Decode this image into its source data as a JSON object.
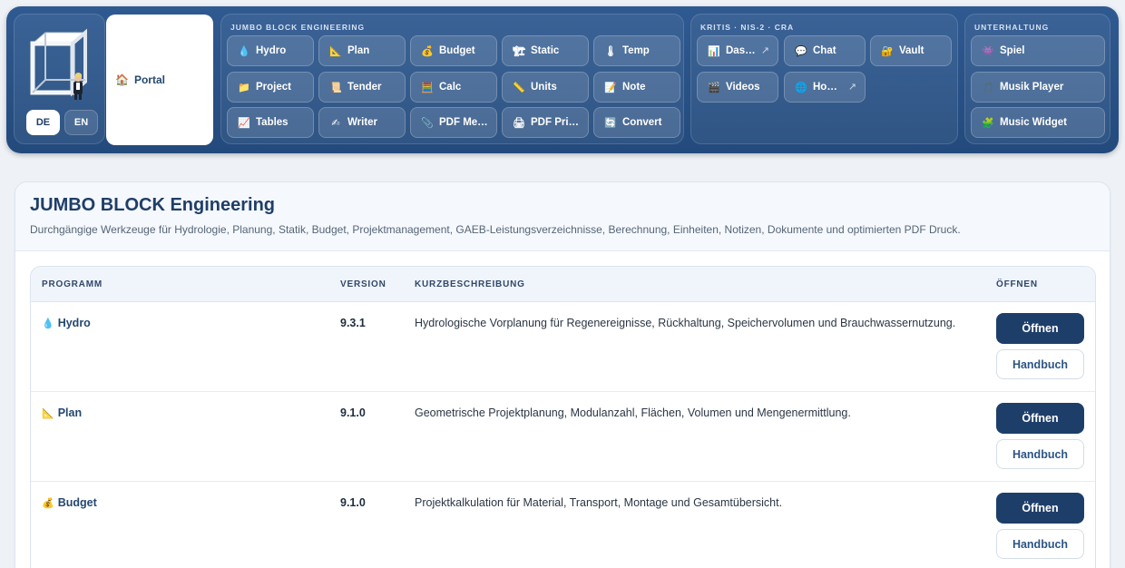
{
  "header": {
    "language": {
      "de": "DE",
      "en": "EN",
      "selected": "DE"
    },
    "portal": {
      "icon": "house-icon",
      "glyph": "🏠",
      "label": "Portal"
    },
    "engineering": {
      "title": "JUMBO BLOCK ENGINEERING",
      "buttons": [
        {
          "label": "Hydro",
          "glyph": "💧",
          "icon": "water-drop-icon"
        },
        {
          "label": "Plan",
          "glyph": "📐",
          "icon": "triangle-ruler-icon"
        },
        {
          "label": "Budget",
          "glyph": "💰",
          "icon": "money-bag-icon"
        },
        {
          "label": "Static",
          "glyph": "🏗",
          "icon": "crane-icon"
        },
        {
          "label": "Temp",
          "glyph": "🌡",
          "icon": "thermometer-icon"
        },
        {
          "label": "Project",
          "glyph": "📁",
          "icon": "folder-icon"
        },
        {
          "label": "Tender",
          "glyph": "📜",
          "icon": "scroll-icon"
        },
        {
          "label": "Calc",
          "glyph": "🧮",
          "icon": "abacus-icon"
        },
        {
          "label": "Units",
          "glyph": "📏",
          "icon": "ruler-icon"
        },
        {
          "label": "Note",
          "glyph": "📝",
          "icon": "memo-icon"
        },
        {
          "label": "Tables",
          "glyph": "📈",
          "icon": "chart-icon"
        },
        {
          "label": "Writer",
          "glyph": "✍",
          "icon": "writing-hand-icon"
        },
        {
          "label": "PDF Me…",
          "glyph": "📎",
          "icon": "paperclip-icon"
        },
        {
          "label": "PDF Pri…",
          "glyph": "🖨",
          "icon": "printer-icon"
        },
        {
          "label": "Convert",
          "glyph": "🔄",
          "icon": "convert-icon"
        }
      ]
    },
    "kritis": {
      "title": "KRITIS · NIS-2 · CRA",
      "buttons": [
        {
          "label": "Das…",
          "glyph": "📊",
          "icon": "dashboard-icon",
          "external": "↗"
        },
        {
          "label": "Chat",
          "glyph": "💬",
          "icon": "chat-bubble-icon"
        },
        {
          "label": "Vault",
          "glyph": "🔐",
          "icon": "lock-icon"
        },
        {
          "label": "Videos",
          "glyph": "🎬",
          "icon": "clapper-icon"
        },
        {
          "label": "Ho…",
          "glyph": "🌐",
          "icon": "globe-icon",
          "external": "↗"
        }
      ]
    },
    "entertainment": {
      "title": "UNTERHALTUNG",
      "buttons": [
        {
          "label": "Spiel",
          "glyph": "👾",
          "icon": "game-icon"
        },
        {
          "label": "Musik Player",
          "glyph": "🎵",
          "icon": "music-note-icon"
        },
        {
          "label": "Music Widget",
          "glyph": "🧩",
          "icon": "puzzle-icon"
        }
      ]
    }
  },
  "main": {
    "title": "JUMBO BLOCK Engineering",
    "subtitle": "Durchgängige Werkzeuge für Hydrologie, Planung, Statik, Budget, Projektmanagement, GAEB-Leistungsverzeichnisse, Berechnung, Einheiten, Notizen, Dokumente und optimierten PDF Druck.",
    "table": {
      "headers": {
        "program": "PROGRAMM",
        "version": "VERSION",
        "description": "KURZBESCHREIBUNG",
        "open": "ÖFFNEN"
      },
      "rows": [
        {
          "glyph": "💧",
          "icon": "water-drop-icon",
          "name": "Hydro",
          "version": "9.3.1",
          "description": "Hydrologische Vorplanung für Regenereignisse, Rückhaltung, Speichervolumen und Brauchwassernutzung.",
          "open_label": "Öffnen",
          "manual_label": "Handbuch"
        },
        {
          "glyph": "📐",
          "icon": "triangle-ruler-icon",
          "name": "Plan",
          "version": "9.1.0",
          "description": "Geometrische Projektplanung, Modulanzahl, Flächen, Volumen und Mengenermittlung.",
          "open_label": "Öffnen",
          "manual_label": "Handbuch"
        },
        {
          "glyph": "💰",
          "icon": "money-bag-icon",
          "name": "Budget",
          "version": "9.1.0",
          "description": "Projektkalkulation für Material, Transport, Montage und Gesamtübersicht.",
          "open_label": "Öffnen",
          "manual_label": "Handbuch"
        }
      ]
    }
  },
  "colors": {
    "header_bg": "#2f5a91",
    "primary_button": "#1e3e6a",
    "title": "#1f3e68"
  }
}
